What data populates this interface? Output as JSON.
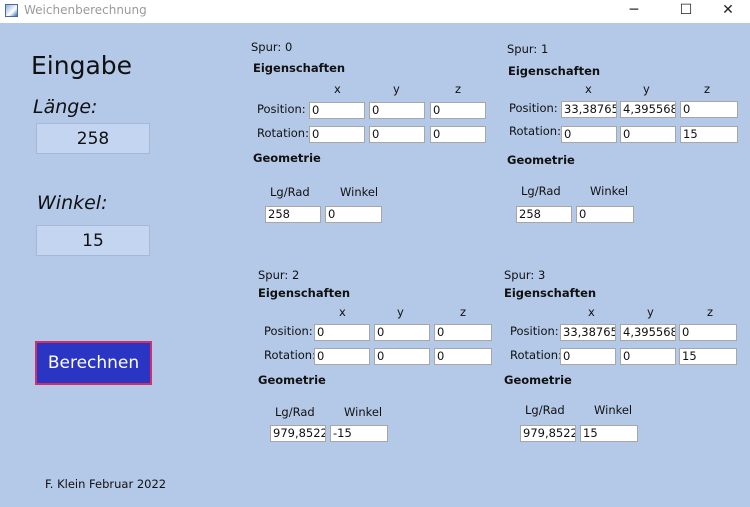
{
  "window": {
    "title": "Weichenberechnung",
    "controls": {
      "minimize": "─",
      "maximize": "☐",
      "close": "✕"
    }
  },
  "input_panel": {
    "heading": "Eingabe",
    "length_label": "Länge:",
    "length_value": "258",
    "angle_label": "Winkel:",
    "angle_value": "15",
    "calculate_button": "Berechnen",
    "footer": "F. Klein Februar 2022"
  },
  "common": {
    "properties_label": "Eigenschaften",
    "geometry_label": "Geometrie",
    "col_x": "x",
    "col_y": "y",
    "col_z": "z",
    "position_label": "Position:",
    "rotation_label": "Rotation:",
    "lgrad_label": "Lg/Rad",
    "angle_label": "Winkel"
  },
  "tracks": [
    {
      "title": "Spur: 0",
      "position": [
        "0",
        "0",
        "0"
      ],
      "rotation": [
        "0",
        "0",
        "0"
      ],
      "lgrad": "258",
      "winkel": "0"
    },
    {
      "title": "Spur: 1",
      "position": [
        "33,38765",
        "4,395568",
        "0"
      ],
      "rotation": [
        "0",
        "0",
        "15"
      ],
      "lgrad": "258",
      "winkel": "0"
    },
    {
      "title": "Spur: 2",
      "position": [
        "0",
        "0",
        "0"
      ],
      "rotation": [
        "0",
        "0",
        "0"
      ],
      "lgrad": "979,8522",
      "winkel": "-15"
    },
    {
      "title": "Spur: 3",
      "position": [
        "33,38765",
        "4,395568",
        "0"
      ],
      "rotation": [
        "0",
        "0",
        "15"
      ],
      "lgrad": "979,8522",
      "winkel": "15"
    }
  ]
}
